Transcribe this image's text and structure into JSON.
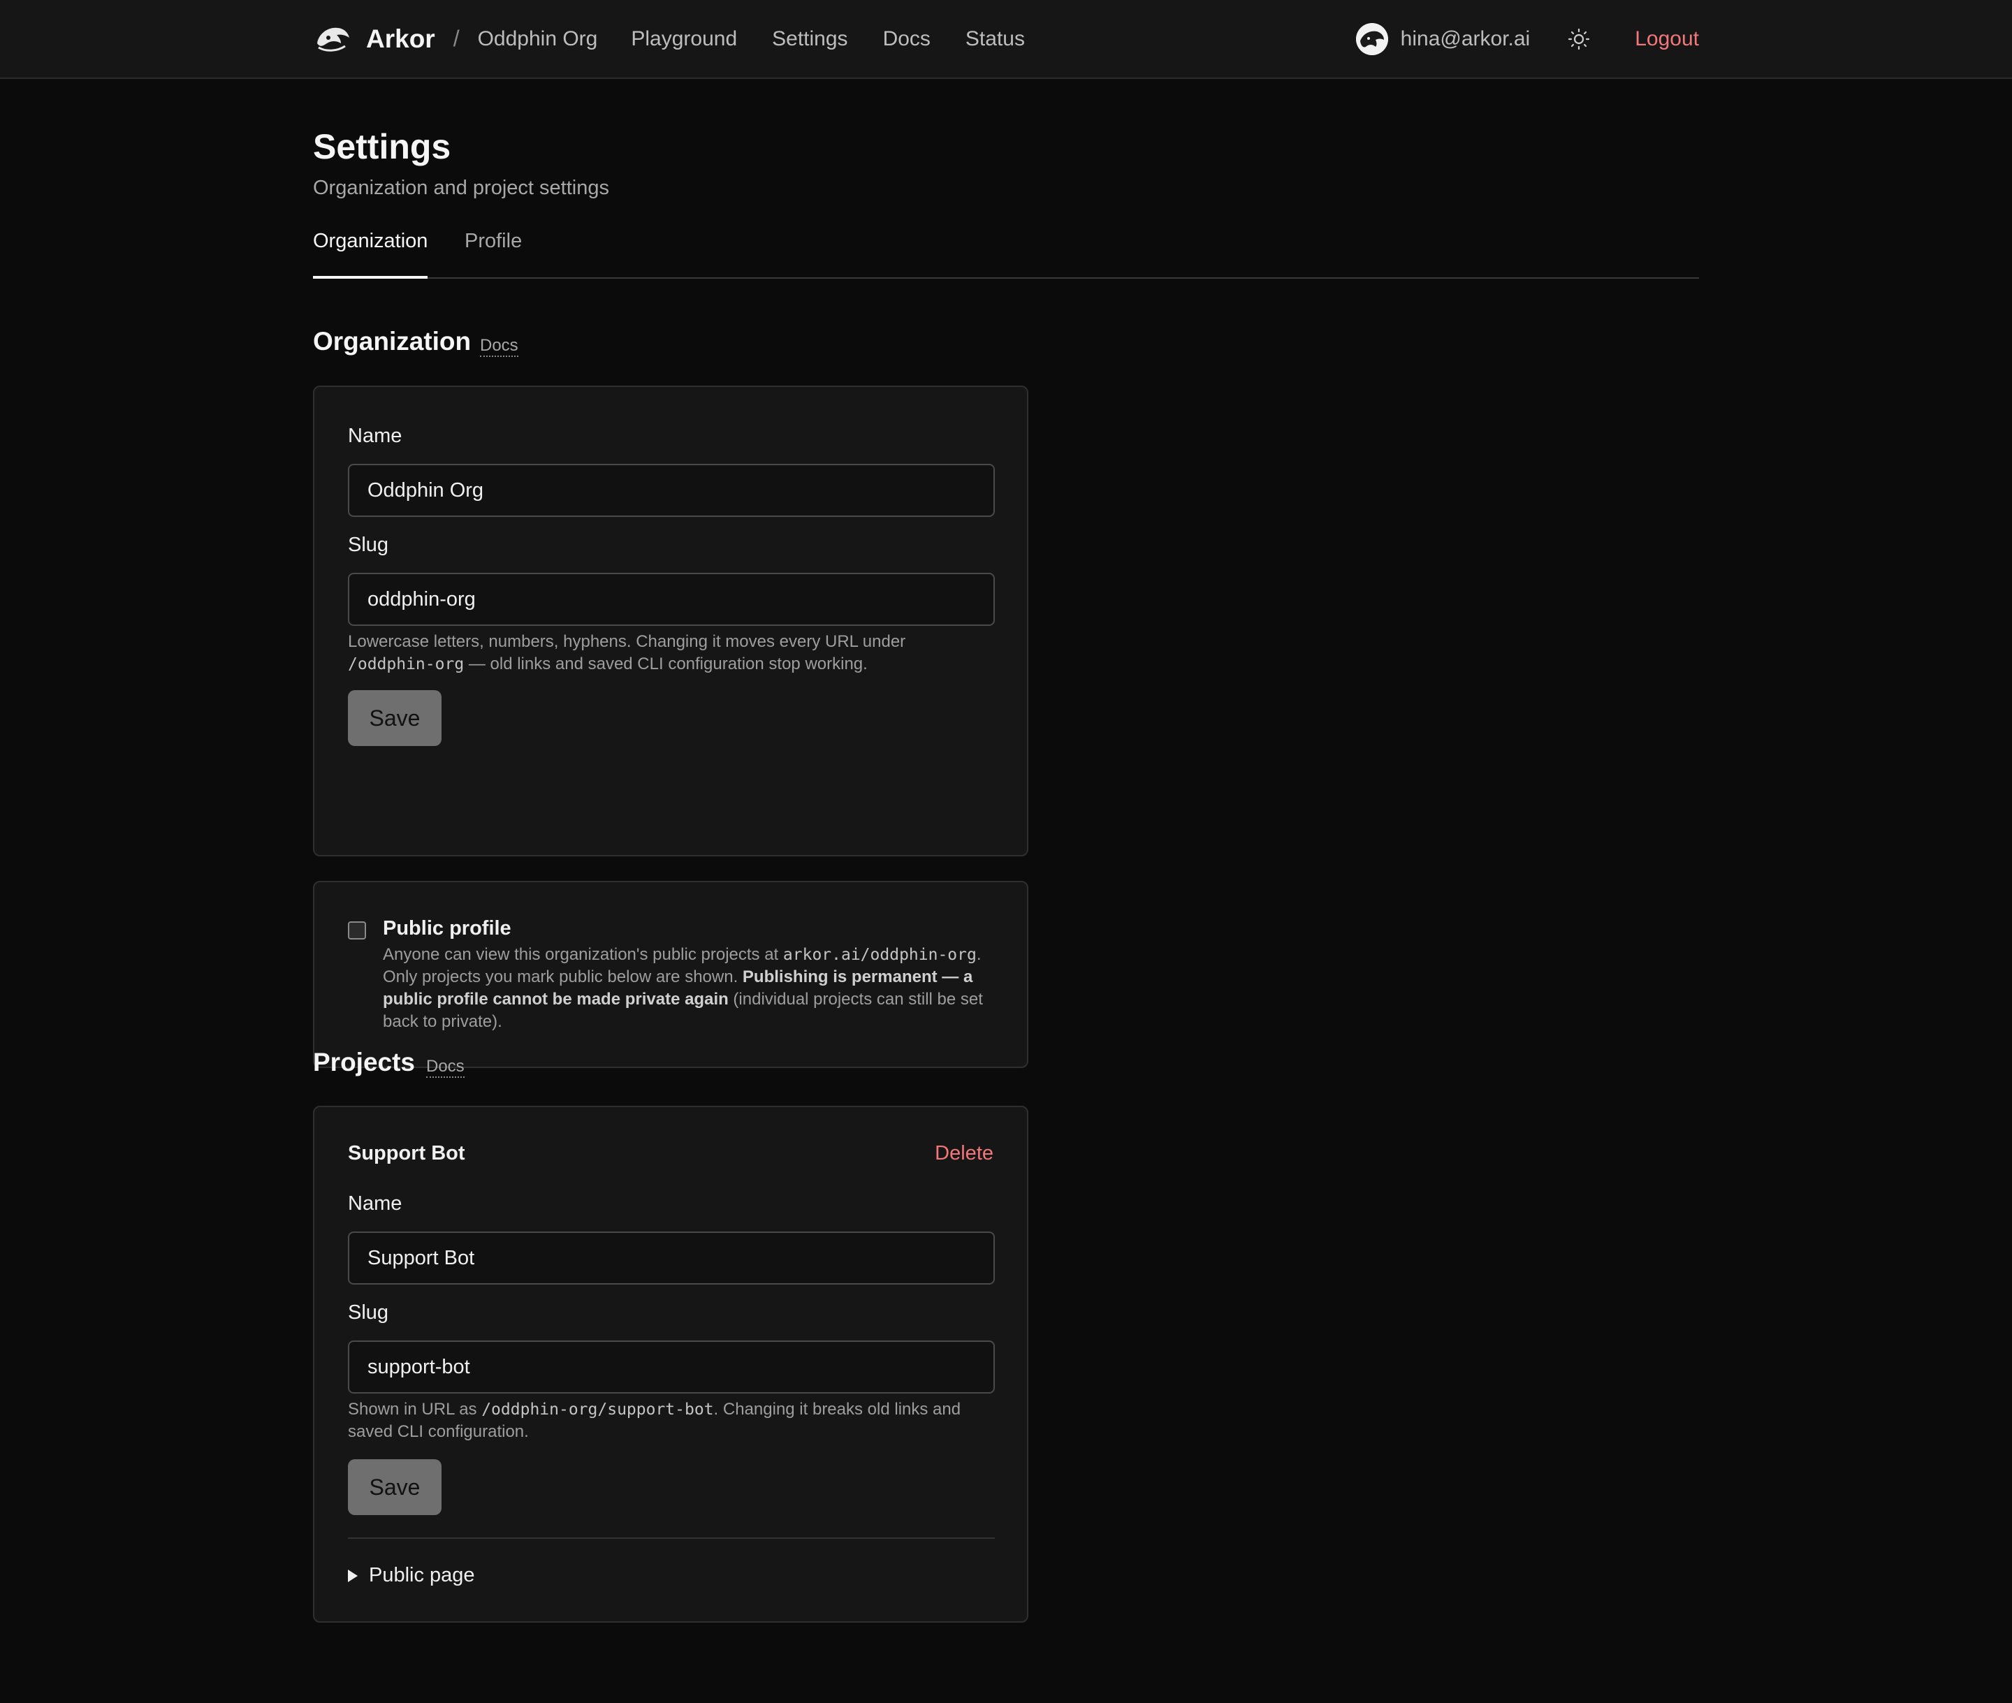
{
  "header": {
    "brand": "Arkor",
    "separator": "/",
    "org_name": "Oddphin Org",
    "nav": [
      "Playground",
      "Settings",
      "Docs",
      "Status"
    ],
    "user_email": "hina@arkor.ai",
    "logout_label": "Logout"
  },
  "page": {
    "title": "Settings",
    "subtitle": "Organization and project settings",
    "tabs": [
      {
        "label": "Organization",
        "active": true
      },
      {
        "label": "Profile",
        "active": false
      }
    ]
  },
  "organization": {
    "section_title": "Organization",
    "docs_label": "Docs",
    "name_label": "Name",
    "name_value": "Oddphin Org",
    "slug_label": "Slug",
    "slug_value": "oddphin-org",
    "slug_hint_pre": "Lowercase letters, numbers, hyphens. Changing it moves every URL under",
    "slug_hint_code": "/oddphin-org",
    "slug_hint_post": " — old links and saved CLI configuration stop working.",
    "save_label": "Save"
  },
  "public_profile": {
    "title": "Public profile",
    "checked": false,
    "desc_pre": "Anyone can view this organization's public projects at ",
    "desc_code": "arkor.ai/oddphin-org",
    "desc_mid": ". Only projects you mark public below are shown. ",
    "desc_bold": "Publishing is permanent — a public profile cannot be made private again",
    "desc_post": " (individual projects can still be set back to private)."
  },
  "projects": {
    "section_title": "Projects",
    "docs_label": "Docs",
    "items": [
      {
        "title": "Support Bot",
        "delete_label": "Delete",
        "name_label": "Name",
        "name_value": "Support Bot",
        "slug_label": "Slug",
        "slug_value": "support-bot",
        "slug_hint_pre": "Shown in URL as ",
        "slug_hint_code": "/oddphin-org/support-bot",
        "slug_hint_post": ". Changing it breaks old links and saved CLI configuration.",
        "save_label": "Save",
        "public_page_label": "Public page"
      }
    ]
  }
}
